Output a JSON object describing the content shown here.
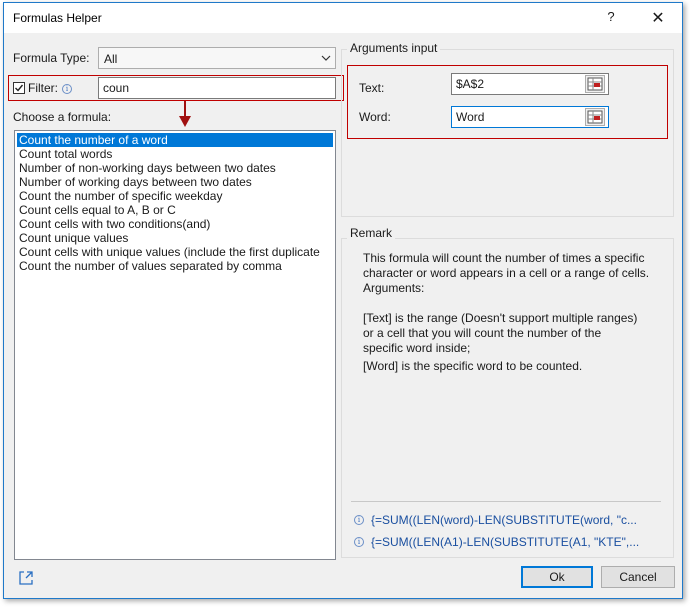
{
  "window": {
    "title": "Formulas Helper",
    "help_glyph": "?",
    "close_glyph": "✕"
  },
  "formula_type": {
    "label": "Formula Type:",
    "selected": "All"
  },
  "filter": {
    "label": "Filter:",
    "checked": true,
    "info_glyph": "i",
    "value": "coun"
  },
  "choose": {
    "label": "Choose a formula:",
    "items": [
      "Count the number of a word",
      "Count total words",
      "Number of non-working days between two dates",
      "Number of working days between two dates",
      "Count the number of specific weekday",
      "Count cells equal to A, B or C",
      "Count cells with two conditions(and)",
      "Count unique values",
      "Count cells with unique values (include the first duplicate",
      "Count the number of values separated by comma"
    ],
    "selected_index": 0
  },
  "arguments": {
    "title": "Arguments input",
    "text": {
      "label": "Text:",
      "value": "$A$2"
    },
    "word": {
      "label": "Word:",
      "value": "Word"
    }
  },
  "remark": {
    "title": "Remark",
    "lines": [
      "This formula will count the number of times a specific",
      "character or word appears in a cell or a range of cells.",
      "Arguments:",
      "[Text] is the range (Doesn't support multiple ranges)",
      "or a cell that you will count the number of the",
      "specific word inside;",
      "[Word] is the specific word to be counted."
    ],
    "formulas": [
      "{=SUM((LEN(word)-LEN(SUBSTITUTE(word, \"c...",
      "{=SUM((LEN(A1)-LEN(SUBSTITUTE(A1, \"KTE\",..."
    ]
  },
  "buttons": {
    "ok": "Ok",
    "cancel": "Cancel"
  },
  "colors": {
    "accent": "#0078d7",
    "highlight_border": "#c00000",
    "formula_text": "#1a4fa0"
  },
  "icons": {
    "share": "share-icon",
    "refedit": "range-select-icon"
  }
}
